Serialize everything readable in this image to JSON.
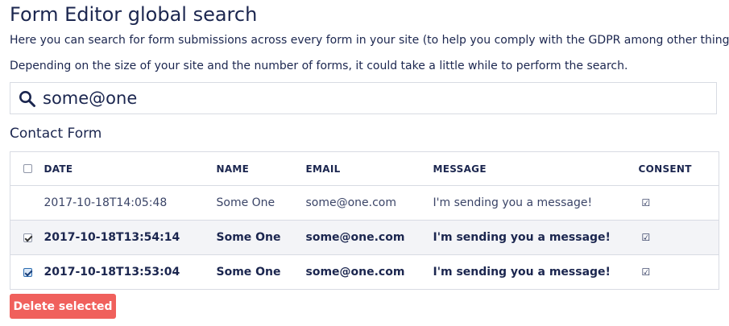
{
  "page": {
    "title": "Form Editor global search",
    "description_1": "Here you can search for form submissions across every form in your site (to help you comply with the GDPR among other things).",
    "description_2": "Depending on the size of your site and the number of forms, it could take a little while to perform the search."
  },
  "search": {
    "icon": "search-icon",
    "value": "some@one"
  },
  "results": {
    "form_name": "Contact Form",
    "columns": [
      "DATE",
      "NAME",
      "EMAIL",
      "MESSAGE",
      "CONSENT"
    ],
    "rows": [
      {
        "selected": false,
        "date": "2017-10-18T14:05:48",
        "name": "Some One",
        "email": "some@one.com",
        "message": "I'm sending you a message!",
        "consent": "☑"
      },
      {
        "selected": true,
        "date": "2017-10-18T13:54:14",
        "name": "Some One",
        "email": "some@one.com",
        "message": "I'm sending you a message!",
        "consent": "☑"
      },
      {
        "selected": true,
        "date": "2017-10-18T13:53:04",
        "name": "Some One",
        "email": "some@one.com",
        "message": "I'm sending you a message!",
        "consent": "☑"
      }
    ]
  },
  "actions": {
    "delete_label": "Delete selected",
    "delete_color": "#f0605c"
  }
}
